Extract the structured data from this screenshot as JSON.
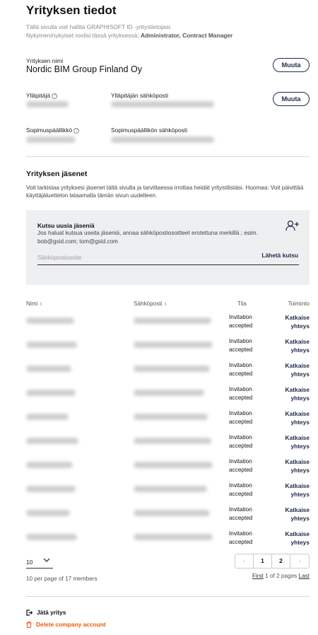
{
  "header": {
    "title": "Yrityksen tiedot",
    "intro_line1": "Tällä sivulla voit hallita GRAPHISOFT ID -yritystietojasi.",
    "intro_line2_prefix": "Nykyinen/nykyiset roolisi tässä yrityksessä:",
    "intro_line2_roles": "Administrator, Contract Manager"
  },
  "company": {
    "name_label": "Yrityksen nimi",
    "name_value": "Nordic BIM Group Finland Oy",
    "change_label": "Muuta",
    "admin_label": "Ylläpitäjä",
    "admin_email_label": "Ylläpitäjän sähköposti",
    "admin_change_label": "Muuta",
    "contract_label": "Sopimuspäällikkö",
    "contract_email_label": "Sopimuspäällikön sähköposti"
  },
  "members": {
    "title": "Yrityksen jäsenet",
    "description": "Voit tarkistaa yrityksesi jäsenet tältä sivulta ja tarvittaessa irrottaa heidät yritystilistäsi. Huomaa: Voit päivittää käyttäjäluettelon lataamalla tämän sivun uudelleen."
  },
  "invite": {
    "title": "Kutsu uusia jäseniä",
    "description": "Jos haluat kutsua useita jäseniä, annaa sähköpostiosoitteet erotettuna merkillä ; esim. bob@gsid.com; tom@gsid.com",
    "placeholder": "Sähköpostiosoite",
    "send_label": "Lähetä kutsu",
    "icon": "add-user-icon"
  },
  "table": {
    "headers": {
      "name": "Nimi",
      "email": "Sähköposti",
      "status": "Tila",
      "action": "Toiminto"
    },
    "rows": [
      {
        "status_line1": "Invitation",
        "status_line2": "accepted",
        "action_line1": "Katkaise",
        "action_line2": "yhteys"
      },
      {
        "status_line1": "Invitation",
        "status_line2": "accepted",
        "action_line1": "Katkaise",
        "action_line2": "yhteys"
      },
      {
        "status_line1": "Invitation",
        "status_line2": "accepted",
        "action_line1": "Katkaise",
        "action_line2": "yhteys"
      },
      {
        "status_line1": "Invitation",
        "status_line2": "accepted",
        "action_line1": "Katkaise",
        "action_line2": "yhteys"
      },
      {
        "status_line1": "Invitation",
        "status_line2": "accepted",
        "action_line1": "Katkaise",
        "action_line2": "yhteys"
      },
      {
        "status_line1": "Invitation",
        "status_line2": "accepted",
        "action_line1": "Katkaise",
        "action_line2": "yhteys"
      },
      {
        "status_line1": "Invitation",
        "status_line2": "accepted",
        "action_line1": "Katkaise",
        "action_line2": "yhteys"
      },
      {
        "status_line1": "Invitation",
        "status_line2": "accepted",
        "action_line1": "Katkaise",
        "action_line2": "yhteys"
      },
      {
        "status_line1": "Invitation",
        "status_line2": "accepted",
        "action_line1": "Katkaise",
        "action_line2": "yhteys"
      },
      {
        "status_line1": "Invitation",
        "status_line2": "accepted",
        "action_line1": "Katkaise",
        "action_line2": "yhteys"
      }
    ]
  },
  "pagination": {
    "per_page_value": "10",
    "per_page_info": "10 per page of 17 members",
    "prev_symbol": "‹",
    "next_symbol": "›",
    "page1": "1",
    "page2": "2",
    "first_label": "First",
    "pages_text": "1 of 2 pages",
    "last_label": "Last"
  },
  "footer": {
    "leave_label": "Jätä yritys",
    "delete_label": "Delete company account",
    "delete_color": "#e85a0c"
  }
}
